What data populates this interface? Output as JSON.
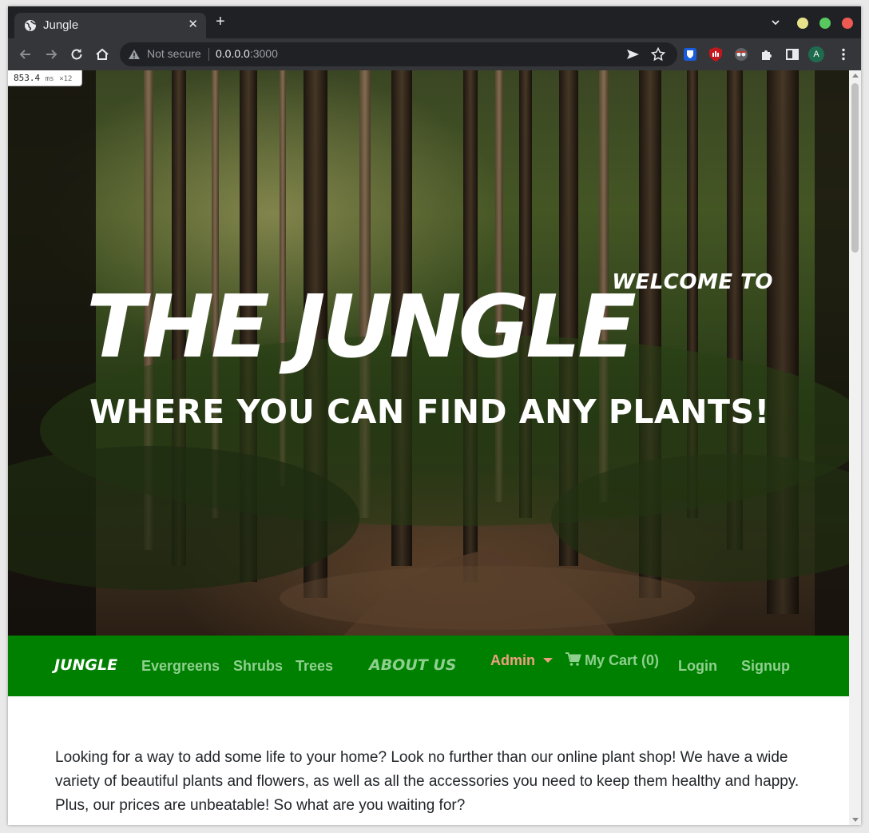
{
  "browser": {
    "tab_title": "Jungle",
    "tab_close": "✕",
    "new_tab": "+",
    "security_label": "Not secure",
    "url_host": "0.0.0.0",
    "url_port": ":3000",
    "profile_initial": "A",
    "window_controls": {
      "minimize_color": "#e8e288",
      "maximize_color": "#58c95e",
      "close_color": "#ed5a52"
    }
  },
  "perf_badge": {
    "value": "853.4",
    "unit": "ms",
    "count": "×12"
  },
  "hero": {
    "welcome": "WELCOME TO",
    "title": "THE JUNGLE",
    "subtitle": "WHERE YOU CAN FIND ANY PLANTS!"
  },
  "navbar": {
    "brand": "JUNGLE",
    "links": [
      "Evergreens",
      "Shrubs",
      "Trees"
    ],
    "about": "ABOUT US",
    "admin": "Admin",
    "cart": "My Cart (0)",
    "login": "Login",
    "signup": "Signup",
    "colors": {
      "background": "#008000",
      "link": "#8fcf8f",
      "admin": "#f0a080"
    }
  },
  "content": {
    "intro": "Looking for a way to add some life to your home? Look no further than our online plant shop! We have a wide variety of beautiful plants and flowers, as well as all the accessories you need to keep them healthy and happy. Plus, our prices are unbeatable! So what are you waiting for?"
  }
}
